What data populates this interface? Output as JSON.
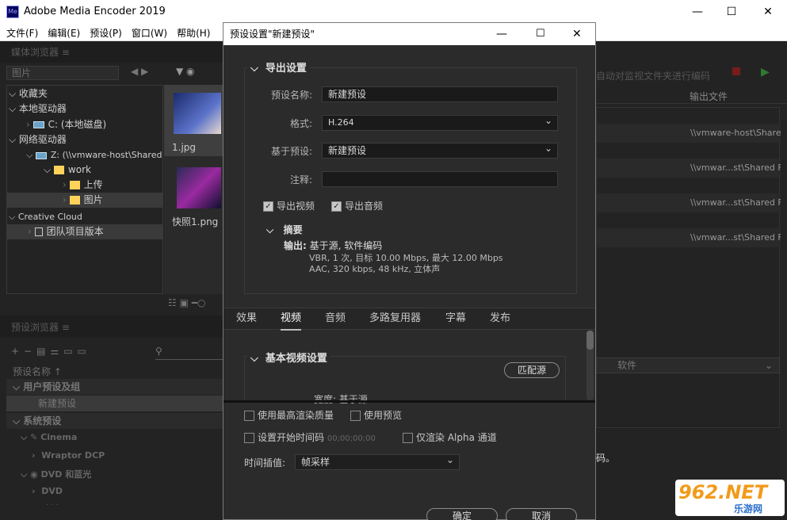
{
  "app": {
    "title": "Adobe Media Encoder 2019",
    "logo_text": "Me"
  },
  "window_controls": {
    "minimize": "—",
    "maximize": "☐",
    "close": "✕"
  },
  "menu": [
    "文件(F)",
    "编辑(E)",
    "预设(P)",
    "窗口(W)",
    "帮助(H)"
  ],
  "media_browser": {
    "title": "媒体浏览器",
    "search_placeholder": "图片",
    "tree": [
      {
        "label": "收藏夹",
        "level": 0
      },
      {
        "label": "本地驱动器",
        "level": 0
      },
      {
        "label": "C: (本地磁盘)",
        "level": 1
      },
      {
        "label": "网络驱动器",
        "level": 0
      },
      {
        "label": "Z: (\\\\vmware-host\\Shared",
        "level": 1
      },
      {
        "label": "work",
        "level": 2
      },
      {
        "label": "上传",
        "level": 3
      },
      {
        "label": "图片",
        "level": 3
      },
      {
        "label": "Creative Cloud",
        "level": 0
      },
      {
        "label": "团队项目版本",
        "level": 1
      }
    ],
    "thumbs": [
      {
        "name": "1.jpg"
      },
      {
        "name": "快照1.png"
      }
    ]
  },
  "preset_browser": {
    "title": "预设浏览器",
    "column": "预设名称 ↑",
    "items": [
      {
        "label": "用户预设及组",
        "bold": true
      },
      {
        "label": "新建预设",
        "sel": true
      },
      {
        "label": "系统预设",
        "bold": true
      },
      {
        "label": "Cinema"
      },
      {
        "label": "Wraptor DCP"
      },
      {
        "label": "DVD 和蓝光"
      },
      {
        "label": "DVD"
      },
      {
        "label": "· · ·"
      }
    ]
  },
  "queue": {
    "auto_encode": "自动对监视文件夹进行编码",
    "output_header": "输出文件",
    "rows": [
      "\\\\vmware-host\\Shared",
      "\\\\vmwar...st\\Shared F",
      "\\\\vmwar...st\\Shared F",
      "\\\\vmwar...st\\Shared F"
    ],
    "renderer": "软件",
    "status_tail": "码。"
  },
  "dialog": {
    "title": "预设设置\"新建预设\"",
    "export_section": "导出设置",
    "preset_name_label": "预设名称:",
    "preset_name": "新建预设",
    "format_label": "格式:",
    "format": "H.264",
    "based_on_label": "基于预设:",
    "based_on": "新建预设",
    "comment_label": "注释:",
    "comment": "",
    "export_video": "导出视频",
    "export_audio": "导出音频",
    "summary_title": "摘要",
    "summary_output_label": "输出:",
    "summary_output": "基于源, 软件编码",
    "summary_video": "VBR, 1 次, 目标 10.00 Mbps, 最大 12.00 Mbps",
    "summary_audio": "AAC, 320 kbps, 48 kHz, 立体声",
    "tabs": [
      "效果",
      "视频",
      "音频",
      "多路复用器",
      "字幕",
      "发布"
    ],
    "active_tab": "视频",
    "video_section": "基本视频设置",
    "match_source": "匹配源",
    "width_text": "宽度:  基于源",
    "max_render": "使用最高渲染质量",
    "use_preview": "使用预览",
    "set_timecode": "设置开始时间码",
    "timecode": "00;00;00;00",
    "alpha_only": "仅渲染 Alpha 通道",
    "time_interp_label": "时间插值:",
    "time_interp": "帧采样",
    "ok": "确定",
    "cancel": "取消"
  },
  "watermark": {
    "text": "962.NET",
    "sub": "乐游网"
  }
}
